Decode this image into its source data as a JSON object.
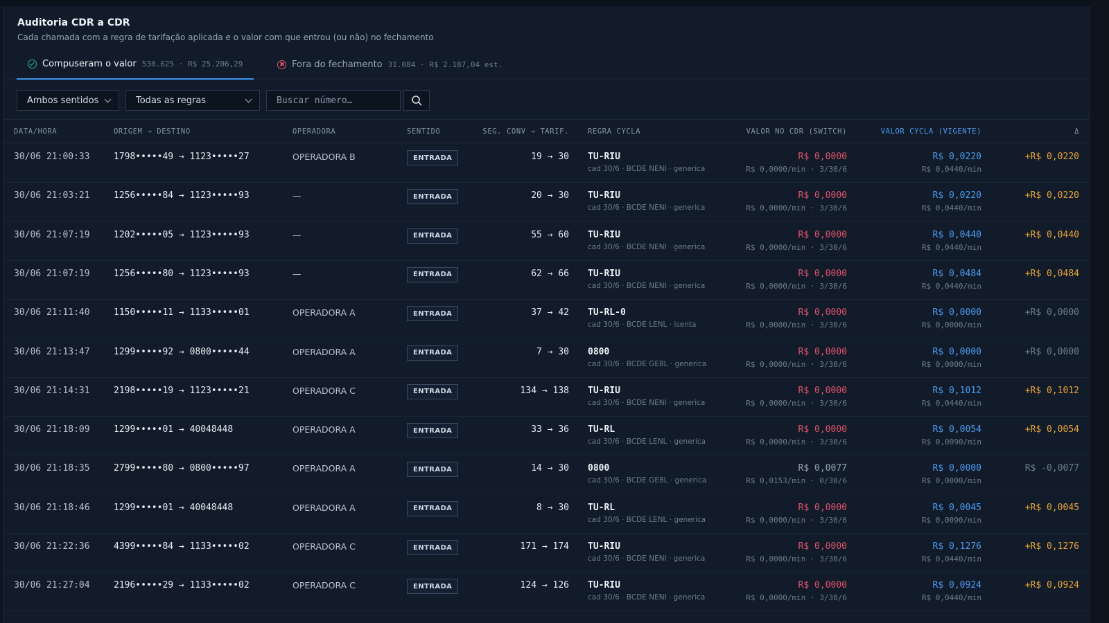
{
  "header": {
    "title": "Auditoria CDR a CDR",
    "subtitle": "Cada chamada com a regra de tarifação aplicada e o valor com que entrou (ou não) no fechamento"
  },
  "tabs": [
    {
      "label": "Compuseram o valor",
      "meta": "530.625 · R$ 25.206,29",
      "active": true,
      "icon": "check-circle-icon"
    },
    {
      "label": "Fora do fechamento",
      "meta": "31.084 · R$ 2.187,04 est.",
      "active": false,
      "icon": "x-circle-icon"
    }
  ],
  "filters": {
    "direction": "Ambos sentidos",
    "rules": "Todas as regras",
    "search_placeholder": "Buscar número…",
    "search_icon": "search-icon"
  },
  "columns": [
    "DATA/HORA",
    "ORIGEM → DESTINO",
    "OPERADORA",
    "SENTIDO",
    "SEG. CONV → TARIF.",
    "REGRA CYCLA",
    "VALOR NO CDR (SWITCH)",
    "VALOR CYCLA (VIGENTE)",
    "Δ"
  ],
  "colors": {
    "accent": "#4d9bf0",
    "negative": "#e0526a",
    "positive": "#e8a33a",
    "ok": "#2fb98a"
  },
  "rows": [
    {
      "datetime": "30/06 21:00:33",
      "route": "1798•••••49 → 1123•••••27",
      "operator": "OPERADORA B",
      "direction": "ENTRADA",
      "seconds": "19 → 30",
      "rule": "TU-RIU",
      "rule_detail": "cad 30/6 · BCDE NENI · generica",
      "cdr_value": "R$ 0,0000",
      "cdr_tone": "red",
      "cdr_detail": "R$ 0,0000/min · 3/30/6",
      "cycla_value": "R$ 0,0220",
      "cycla_detail": "R$ 0,0440/min",
      "delta": "+R$ 0,0220",
      "delta_tone": "orange"
    },
    {
      "datetime": "30/06 21:03:21",
      "route": "1256•••••84 → 1123•••••93",
      "operator": "—",
      "direction": "ENTRADA",
      "seconds": "20 → 30",
      "rule": "TU-RIU",
      "rule_detail": "cad 30/6 · BCDE NENI · generica",
      "cdr_value": "R$ 0,0000",
      "cdr_tone": "red",
      "cdr_detail": "R$ 0,0000/min · 3/30/6",
      "cycla_value": "R$ 0,0220",
      "cycla_detail": "R$ 0,0440/min",
      "delta": "+R$ 0,0220",
      "delta_tone": "orange"
    },
    {
      "datetime": "30/06 21:07:19",
      "route": "1202•••••05 → 1123•••••93",
      "operator": "—",
      "direction": "ENTRADA",
      "seconds": "55 → 60",
      "rule": "TU-RIU",
      "rule_detail": "cad 30/6 · BCDE NENI · generica",
      "cdr_value": "R$ 0,0000",
      "cdr_tone": "red",
      "cdr_detail": "R$ 0,0000/min · 3/30/6",
      "cycla_value": "R$ 0,0440",
      "cycla_detail": "R$ 0,0440/min",
      "delta": "+R$ 0,0440",
      "delta_tone": "orange"
    },
    {
      "datetime": "30/06 21:07:19",
      "route": "1256•••••80 → 1123•••••93",
      "operator": "—",
      "direction": "ENTRADA",
      "seconds": "62 → 66",
      "rule": "TU-RIU",
      "rule_detail": "cad 30/6 · BCDE NENI · generica",
      "cdr_value": "R$ 0,0000",
      "cdr_tone": "red",
      "cdr_detail": "R$ 0,0000/min · 3/30/6",
      "cycla_value": "R$ 0,0484",
      "cycla_detail": "R$ 0,0440/min",
      "delta": "+R$ 0,0484",
      "delta_tone": "orange"
    },
    {
      "datetime": "30/06 21:11:40",
      "route": "1150•••••11 → 1133•••••01",
      "operator": "OPERADORA A",
      "direction": "ENTRADA",
      "seconds": "37 → 42",
      "rule": "TU-RL-0",
      "rule_detail": "cad 30/6 · BCDE LENL · isenta",
      "cdr_value": "R$ 0,0000",
      "cdr_tone": "red",
      "cdr_detail": "R$ 0,0000/min · 3/30/6",
      "cycla_value": "R$ 0,0000",
      "cycla_detail": "R$ 0,0000/min",
      "delta": "+R$ 0,0000",
      "delta_tone": "muted"
    },
    {
      "datetime": "30/06 21:13:47",
      "route": "1299•••••92 → 0800•••••44",
      "operator": "OPERADORA A",
      "direction": "ENTRADA",
      "seconds": "7 → 30",
      "rule": "0800",
      "rule_detail": "cad 30/6 · BCDE GE8L · generica",
      "cdr_value": "R$ 0,0000",
      "cdr_tone": "red",
      "cdr_detail": "R$ 0,0000/min · 3/30/6",
      "cycla_value": "R$ 0,0000",
      "cycla_detail": "R$ 0,0000/min",
      "delta": "+R$ 0,0000",
      "delta_tone": "muted"
    },
    {
      "datetime": "30/06 21:14:31",
      "route": "2198•••••19 → 1123•••••21",
      "operator": "OPERADORA C",
      "direction": "ENTRADA",
      "seconds": "134 → 138",
      "rule": "TU-RIU",
      "rule_detail": "cad 30/6 · BCDE NENI · generica",
      "cdr_value": "R$ 0,0000",
      "cdr_tone": "red",
      "cdr_detail": "R$ 0,0000/min · 3/30/6",
      "cycla_value": "R$ 0,1012",
      "cycla_detail": "R$ 0,0440/min",
      "delta": "+R$ 0,1012",
      "delta_tone": "orange"
    },
    {
      "datetime": "30/06 21:18:09",
      "route": "1299•••••01 → 40048448",
      "operator": "OPERADORA A",
      "direction": "ENTRADA",
      "seconds": "33 → 36",
      "rule": "TU-RL",
      "rule_detail": "cad 30/6 · BCDE LENL · generica",
      "cdr_value": "R$ 0,0000",
      "cdr_tone": "red",
      "cdr_detail": "R$ 0,0000/min · 3/30/6",
      "cycla_value": "R$ 0,0054",
      "cycla_detail": "R$ 0,0090/min",
      "delta": "+R$ 0,0054",
      "delta_tone": "orange"
    },
    {
      "datetime": "30/06 21:18:35",
      "route": "2799•••••80 → 0800•••••97",
      "operator": "OPERADORA A",
      "direction": "ENTRADA",
      "seconds": "14 → 30",
      "rule": "0800",
      "rule_detail": "cad 30/6 · BCDE GE8L · generica",
      "cdr_value": "R$ 0,0077",
      "cdr_tone": "gray",
      "cdr_detail": "R$ 0,0153/min · 0/30/6",
      "cycla_value": "R$ 0,0000",
      "cycla_detail": "R$ 0,0000/min",
      "delta": "R$ -0,0077",
      "delta_tone": "muted"
    },
    {
      "datetime": "30/06 21:18:46",
      "route": "1299•••••01 → 40048448",
      "operator": "OPERADORA A",
      "direction": "ENTRADA",
      "seconds": "8 → 30",
      "rule": "TU-RL",
      "rule_detail": "cad 30/6 · BCDE LENL · generica",
      "cdr_value": "R$ 0,0000",
      "cdr_tone": "red",
      "cdr_detail": "R$ 0,0000/min · 3/30/6",
      "cycla_value": "R$ 0,0045",
      "cycla_detail": "R$ 0,0090/min",
      "delta": "+R$ 0,0045",
      "delta_tone": "orange"
    },
    {
      "datetime": "30/06 21:22:36",
      "route": "4399•••••84 → 1133•••••02",
      "operator": "OPERADORA C",
      "direction": "ENTRADA",
      "seconds": "171 → 174",
      "rule": "TU-RIU",
      "rule_detail": "cad 30/6 · BCDE NENI · generica",
      "cdr_value": "R$ 0,0000",
      "cdr_tone": "red",
      "cdr_detail": "R$ 0,0000/min · 3/30/6",
      "cycla_value": "R$ 0,1276",
      "cycla_detail": "R$ 0,0440/min",
      "delta": "+R$ 0,1276",
      "delta_tone": "orange"
    },
    {
      "datetime": "30/06 21:27:04",
      "route": "2196•••••29 → 1133•••••02",
      "operator": "OPERADORA C",
      "direction": "ENTRADA",
      "seconds": "124 → 126",
      "rule": "TU-RIU",
      "rule_detail": "cad 30/6 · BCDE NENI · generica",
      "cdr_value": "R$ 0,0000",
      "cdr_tone": "red",
      "cdr_detail": "R$ 0,0000/min · 3/30/6",
      "cycla_value": "R$ 0,0924",
      "cycla_detail": "R$ 0,0440/min",
      "delta": "+R$ 0,0924",
      "delta_tone": "orange"
    }
  ]
}
